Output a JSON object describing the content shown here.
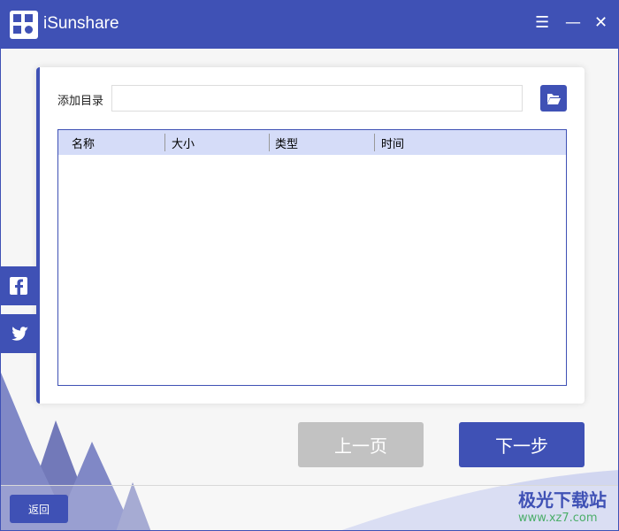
{
  "app": {
    "title": "iSunshare"
  },
  "window_controls": {
    "menu": "☰",
    "minimize": "—",
    "close": "✕"
  },
  "main": {
    "add_dir_label": "添加目录",
    "dir_value": "",
    "columns": [
      "名称",
      "大小",
      "类型",
      "时间"
    ]
  },
  "buttons": {
    "prev": "上一页",
    "next": "下一步",
    "back": "返回"
  },
  "watermark": {
    "name": "极光下载站",
    "url": "www.xz7.com"
  },
  "colors": {
    "accent": "#3f51b5",
    "disabled": "#c2c2c2"
  }
}
